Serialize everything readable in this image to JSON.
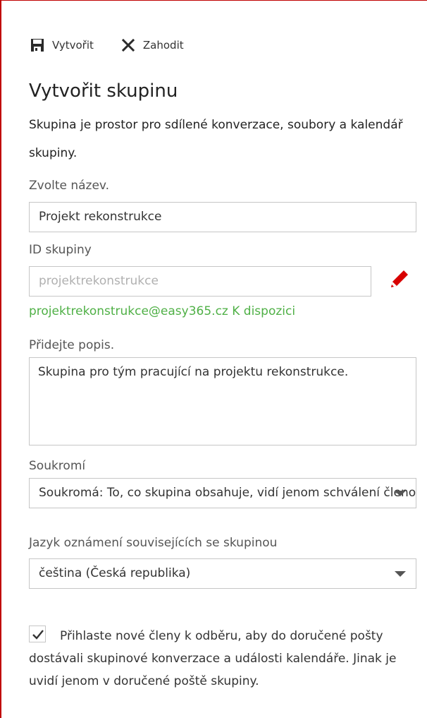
{
  "toolbar": {
    "create_label": "Vytvořit",
    "discard_label": "Zahodit"
  },
  "form": {
    "title": "Vytvořit skupinu",
    "intro": "Skupina je prostor pro sdílené konverzace, soubory a kalendář skupiny.",
    "name": {
      "label": "Zvolte název.",
      "value": "Projekt rekonstrukce"
    },
    "group_id": {
      "label": "ID skupiny",
      "placeholder": "projektrekonstrukce",
      "availability": "projektrekonstrukce@easy365.cz K dispozici"
    },
    "description": {
      "label": "Přidejte popis.",
      "value": "Skupina pro tým pracující na projektu rekonstrukce."
    },
    "privacy": {
      "label": "Soukromí",
      "value": "Soukromá: To, co skupina obsahuje, vidí jenom schválení členové"
    },
    "language": {
      "label": "Jazyk oznámení souvisejících se skupinou",
      "value": "čeština (Česká republika)"
    },
    "subscribe": {
      "checked": true,
      "text": "Přihlaste nové členy k odběru, aby do doručené pošty dostávali skupinové konverzace a události kalendáře. Jinak je uvidí jenom v doručené poště skupiny."
    }
  },
  "colors": {
    "accent_red": "#c00000",
    "available_green": "#4fb046",
    "pencil_red": "#d80000"
  }
}
